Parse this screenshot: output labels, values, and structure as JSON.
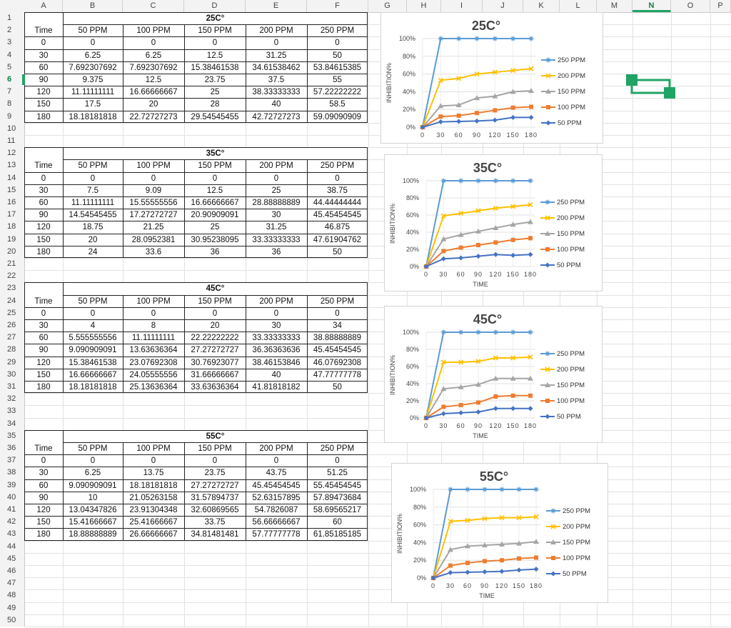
{
  "columns": [
    "A",
    "B",
    "C",
    "D",
    "E",
    "F",
    "G",
    "H",
    "I",
    "J",
    "K",
    "L",
    "M",
    "N",
    "O",
    "P"
  ],
  "selected_column": "N",
  "selected_row": 6,
  "rows": 50,
  "tables": [
    {
      "title": "25C°",
      "header": [
        "Time",
        "50 PPM",
        "100 PPM",
        "150 PPM",
        "200 PPM",
        "250 PPM"
      ],
      "data": [
        [
          "0",
          "0",
          "0",
          "0",
          "0",
          "0"
        ],
        [
          "30",
          "6.25",
          "6.25",
          "12.5",
          "31.25",
          "50"
        ],
        [
          "60",
          "7.692307692",
          "7.692307692",
          "15.38461538",
          "34.61538462",
          "53.84615385"
        ],
        [
          "90",
          "9.375",
          "12.5",
          "23.75",
          "37.5",
          "55"
        ],
        [
          "120",
          "11.11111111",
          "16.66666667",
          "25",
          "38.33333333",
          "57.22222222"
        ],
        [
          "150",
          "17.5",
          "20",
          "28",
          "40",
          "58.5"
        ],
        [
          "180",
          "18.18181818",
          "22.72727273",
          "29.54545455",
          "42.72727273",
          "59.09090909"
        ]
      ]
    },
    {
      "title": "35C°",
      "header": [
        "Time",
        "50 PPM",
        "100 PPM",
        "150 PPM",
        "200 PPM",
        "250 PPM"
      ],
      "data": [
        [
          "0",
          "0",
          "0",
          "0",
          "0",
          "0"
        ],
        [
          "30",
          "7.5",
          "9.09",
          "12.5",
          "25",
          "38.75"
        ],
        [
          "60",
          "11.11111111",
          "15.55555556",
          "16.66666667",
          "28.88888889",
          "44.44444444"
        ],
        [
          "90",
          "14.54545455",
          "17.27272727",
          "20.90909091",
          "30",
          "45.45454545"
        ],
        [
          "120",
          "18.75",
          "21.25",
          "25",
          "31.25",
          "46.875"
        ],
        [
          "150",
          "20",
          "28.0952381",
          "30.95238095",
          "33.33333333",
          "47.61904762"
        ],
        [
          "180",
          "24",
          "33.6",
          "36",
          "36",
          "50"
        ]
      ]
    },
    {
      "title": "45C°",
      "header": [
        "Time",
        "50 PPM",
        "100 PPM",
        "150 PPM",
        "200 PPM",
        "250 PPM"
      ],
      "data": [
        [
          "0",
          "0",
          "0",
          "0",
          "0",
          "0"
        ],
        [
          "30",
          "4",
          "8",
          "20",
          "30",
          "34"
        ],
        [
          "60",
          "5.555555556",
          "11.11111111",
          "22.22222222",
          "33.33333333",
          "38.88888889"
        ],
        [
          "90",
          "9.090909091",
          "13.63636364",
          "27.27272727",
          "36.36363636",
          "45.45454545"
        ],
        [
          "120",
          "15.38461538",
          "23.07692308",
          "30.76923077",
          "38.46153846",
          "46.07692308"
        ],
        [
          "150",
          "16.66666667",
          "24.05555556",
          "31.66666667",
          "40",
          "47.77777778"
        ],
        [
          "180",
          "18.18181818",
          "25.13636364",
          "33.63636364",
          "41.81818182",
          "50"
        ]
      ]
    },
    {
      "title": "55C°",
      "header": [
        "Time",
        "50 PPM",
        "100 PPM",
        "150 PPM",
        "200 PPM",
        "250 PPM"
      ],
      "data": [
        [
          "0",
          "0",
          "0",
          "0",
          "0",
          "0"
        ],
        [
          "30",
          "6.25",
          "13.75",
          "23.75",
          "43.75",
          "51.25"
        ],
        [
          "60",
          "9.090909091",
          "18.18181818",
          "27.27272727",
          "45.45454545",
          "55.45454545"
        ],
        [
          "90",
          "10",
          "21.05263158",
          "31.57894737",
          "52.63157895",
          "57.89473684"
        ],
        [
          "120",
          "13.04347826",
          "23.91304348",
          "32.60869565",
          "54.7826087",
          "58.69565217"
        ],
        [
          "150",
          "15.41666667",
          "25.41666667",
          "33.75",
          "56.66666667",
          "60"
        ],
        [
          "180",
          "18.88888889",
          "26.66666667",
          "34.81481481",
          "57.77777778",
          "61.85185185"
        ]
      ]
    }
  ],
  "chart_data": [
    {
      "type": "line",
      "title": "25C°",
      "xlabel": "",
      "ylabel": "INHIBITION%",
      "x": [
        0,
        30,
        60,
        90,
        120,
        150,
        180
      ],
      "y_ticks": [
        "0%",
        "20%",
        "40%",
        "60%",
        "80%",
        "100%"
      ],
      "ylim": [
        0,
        100
      ],
      "grid": true,
      "legend": "right",
      "series": [
        {
          "name": "250 PPM",
          "color": "#5b9bd5",
          "marker": "star",
          "values": [
            0,
            100,
            100,
            100,
            100,
            100,
            100
          ]
        },
        {
          "name": "200 PPM",
          "color": "#ffc000",
          "marker": "x",
          "values": [
            0,
            53,
            55,
            60,
            62,
            64,
            66
          ]
        },
        {
          "name": "150 PPM",
          "color": "#a5a5a5",
          "marker": "triangle",
          "values": [
            0,
            24,
            25,
            33,
            35,
            40,
            41
          ]
        },
        {
          "name": "100 PPM",
          "color": "#ed7d31",
          "marker": "square",
          "values": [
            0,
            12,
            13,
            16,
            19,
            22,
            23
          ]
        },
        {
          "name": "50 PPM",
          "color": "#4472c4",
          "marker": "diamond",
          "values": [
            0,
            6,
            6.5,
            7,
            8,
            11,
            11
          ]
        }
      ]
    },
    {
      "type": "line",
      "title": "35C°",
      "xlabel": "TIME",
      "ylabel": "INHIBITION%",
      "x": [
        0,
        30,
        60,
        90,
        120,
        150,
        180
      ],
      "y_ticks": [
        "0%",
        "20%",
        "40%",
        "60%",
        "80%",
        "100%"
      ],
      "ylim": [
        0,
        100
      ],
      "grid": true,
      "legend": "right",
      "series": [
        {
          "name": "250 PPM",
          "color": "#5b9bd5",
          "marker": "star",
          "values": [
            0,
            100,
            100,
            100,
            100,
            100,
            100
          ]
        },
        {
          "name": "200 PPM",
          "color": "#ffc000",
          "marker": "x",
          "values": [
            0,
            59,
            62,
            65,
            68,
            70,
            72
          ]
        },
        {
          "name": "150 PPM",
          "color": "#a5a5a5",
          "marker": "triangle",
          "values": [
            0,
            32,
            37,
            41,
            45,
            49,
            52
          ]
        },
        {
          "name": "100 PPM",
          "color": "#ed7d31",
          "marker": "square",
          "values": [
            0,
            18,
            22,
            25,
            28,
            31,
            33
          ]
        },
        {
          "name": "50 PPM",
          "color": "#4472c4",
          "marker": "diamond",
          "values": [
            0,
            9,
            10,
            12,
            14,
            13,
            14
          ]
        }
      ]
    },
    {
      "type": "line",
      "title": "45C°",
      "xlabel": "TIME",
      "ylabel": "INHIBITION%",
      "x": [
        0,
        30,
        60,
        90,
        120,
        150,
        180
      ],
      "y_ticks": [
        "0%",
        "20%",
        "40%",
        "60%",
        "80%",
        "100%"
      ],
      "ylim": [
        0,
        100
      ],
      "grid": true,
      "legend": "right",
      "series": [
        {
          "name": "250 PPM",
          "color": "#5b9bd5",
          "marker": "star",
          "values": [
            0,
            100,
            100,
            100,
            100,
            100,
            100
          ]
        },
        {
          "name": "200 PPM",
          "color": "#ffc000",
          "marker": "x",
          "values": [
            0,
            65,
            65,
            66,
            70,
            70,
            71
          ]
        },
        {
          "name": "150 PPM",
          "color": "#a5a5a5",
          "marker": "triangle",
          "values": [
            0,
            34,
            36,
            39,
            46,
            46,
            46
          ]
        },
        {
          "name": "100 PPM",
          "color": "#ed7d31",
          "marker": "square",
          "values": [
            0,
            13,
            15,
            18,
            25,
            26,
            26
          ]
        },
        {
          "name": "50 PPM",
          "color": "#4472c4",
          "marker": "diamond",
          "values": [
            0,
            5,
            6,
            7,
            11,
            11,
            11
          ]
        }
      ]
    },
    {
      "type": "line",
      "title": "55C°",
      "xlabel": "TIME",
      "ylabel": "INHIBITION%",
      "x": [
        0,
        30,
        60,
        90,
        120,
        150,
        180
      ],
      "y_ticks": [
        "0%",
        "20%",
        "40%",
        "60%",
        "80%",
        "100%"
      ],
      "ylim": [
        0,
        100
      ],
      "grid": true,
      "legend": "right",
      "series": [
        {
          "name": "250 PPM",
          "color": "#5b9bd5",
          "marker": "star",
          "values": [
            0,
            100,
            100,
            100,
            100,
            100,
            100
          ]
        },
        {
          "name": "200 PPM",
          "color": "#ffc000",
          "marker": "x",
          "values": [
            0,
            64,
            65,
            67,
            68,
            68,
            69
          ]
        },
        {
          "name": "150 PPM",
          "color": "#a5a5a5",
          "marker": "triangle",
          "values": [
            0,
            32,
            36,
            37,
            38,
            39,
            41
          ]
        },
        {
          "name": "100 PPM",
          "color": "#ed7d31",
          "marker": "square",
          "values": [
            0,
            14,
            17,
            19,
            20,
            22,
            23
          ]
        },
        {
          "name": "50 PPM",
          "color": "#4472c4",
          "marker": "diamond",
          "values": [
            0,
            6,
            6.5,
            7,
            7.5,
            9,
            10
          ]
        }
      ]
    }
  ],
  "selection_handles_color": "#21a366",
  "icons": [
    "selection-handle-icon"
  ]
}
